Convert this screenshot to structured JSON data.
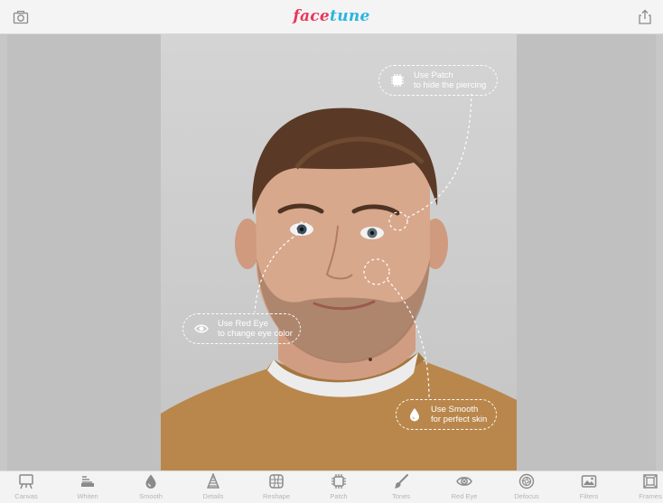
{
  "app": {
    "logo_part1": "face",
    "logo_part2": "tune"
  },
  "colors": {
    "logo_pink": "#e8365d",
    "logo_blue": "#2bb5e0",
    "toolbar_icon": "#8a8a8a"
  },
  "header": {
    "left_icon": "camera-icon",
    "right_icon": "share-icon"
  },
  "callouts": [
    {
      "icon": "patch-icon",
      "line1": "Use Patch",
      "line2": "to hide the piercing"
    },
    {
      "icon": "eye-icon",
      "line1": "Use Red Eye",
      "line2": "to change eye color"
    },
    {
      "icon": "drop-icon",
      "line1": "Use Smooth",
      "line2": "for perfect skin"
    }
  ],
  "tools": [
    {
      "label": "Canvas",
      "icon": "canvas-icon"
    },
    {
      "label": "Whiten",
      "icon": "whiten-icon"
    },
    {
      "label": "Smooth",
      "icon": "drop-icon"
    },
    {
      "label": "Details",
      "icon": "details-icon"
    },
    {
      "label": "Reshape",
      "icon": "reshape-icon"
    },
    {
      "label": "Patch",
      "icon": "patch-icon"
    },
    {
      "label": "Tones",
      "icon": "brush-icon"
    },
    {
      "label": "Red Eye",
      "icon": "eye-icon"
    },
    {
      "label": "Defocus",
      "icon": "defocus-icon"
    },
    {
      "label": "Filters",
      "icon": "filters-icon"
    },
    {
      "label": "Frames",
      "icon": "frames-icon"
    }
  ]
}
